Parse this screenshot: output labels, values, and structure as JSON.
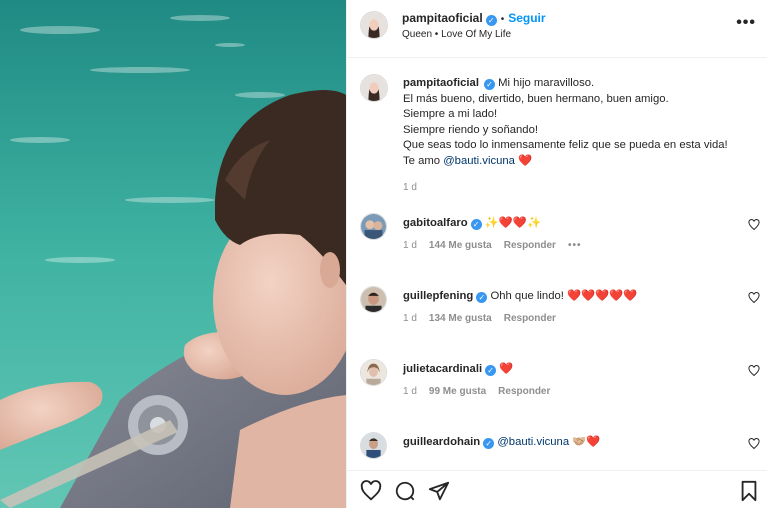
{
  "post": {
    "author": "pampitaoficial",
    "follow_label": "Seguir",
    "separator": "•",
    "song": "Queen • Love Of My Life",
    "more_icon": "more-horizontal-icon"
  },
  "caption": {
    "author": "pampitaoficial",
    "lines": [
      "Mi hijo maravilloso.",
      "El más bueno, divertido, buen hermano, buen amigo.",
      "Siempre a mi lado!",
      "Siempre riendo y soñando!",
      "Que seas todo lo inmensamente feliz que se pueda en esta vida!"
    ],
    "last_line_prefix": "Te amo ",
    "mention": "@bauti.vicuna",
    "last_line_emoji": "❤️",
    "time": "1 d"
  },
  "comments": [
    {
      "user": "gabitoalfaro",
      "text": "✨❤️❤️✨",
      "time": "1 d",
      "likes": "144 Me gusta",
      "reply": "Responder",
      "more": "•••"
    },
    {
      "user": "guillepfening",
      "text": "Ohh que lindo! ❤️❤️❤️❤️❤️",
      "time": "1 d",
      "likes": "134 Me gusta",
      "reply": "Responder"
    },
    {
      "user": "julietacardinali",
      "text": "❤️",
      "time": "1 d",
      "likes": "99 Me gusta",
      "reply": "Responder"
    },
    {
      "user": "guilleardohain",
      "mention": "@bauti.vicuna",
      "text": " 🤝🏼❤️"
    }
  ],
  "actions": {
    "like_icon": "heart-icon",
    "comment_icon": "comment-icon",
    "share_icon": "send-icon",
    "save_icon": "bookmark-icon"
  },
  "colors": {
    "accent": "#0095f6",
    "verified": "#3897f0",
    "secondary_text": "#8e8e8e",
    "heart": "#e0245e"
  }
}
